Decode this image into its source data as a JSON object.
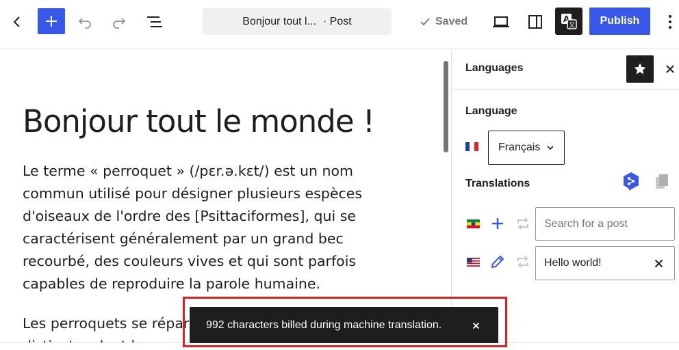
{
  "toolbar": {
    "document_title": "Bonjour tout l...",
    "post_type": "· Post",
    "saved_label": "Saved",
    "publish_label": "Publish"
  },
  "post": {
    "title": "Bonjour tout le monde !",
    "paragraph_1": "Le terme « perroquet » (/pɛr.ə.kɛt/) est un nom commun utilisé pour désigner plusieurs espèces d'oiseaux de l'ordre des [Psittaciformes], qui se caractérisent généralement par un grand bec recourbé, des couleurs vives et qui sont parfois capables de reproduire la parole humaine.",
    "paragraph_2": "Les perroquets se répartissent en plusieurs familles distinctes dont les perroquets."
  },
  "panel": {
    "title": "Languages",
    "language_heading": "Language",
    "selected_language": "Français",
    "translations_heading": "Translations",
    "search_placeholder": "Search for a post",
    "linked_post_title": "Hello world!"
  },
  "snackbar": {
    "message": "992 characters billed during machine translation."
  },
  "colors": {
    "accent": "#3858e9",
    "dark": "#1e1e1e",
    "highlight": "#e0201e"
  },
  "icons": [
    "back-arrow-icon",
    "plus-icon",
    "undo-icon",
    "redo-icon",
    "document-overview-icon",
    "check-icon",
    "laptop-preview-icon",
    "sidebar-icon",
    "translate-icon",
    "more-vertical-icon",
    "star-icon",
    "close-icon",
    "chevron-down-icon",
    "deepl-icon",
    "copy-icon",
    "plus-icon",
    "pencil-icon",
    "sync-icon"
  ]
}
